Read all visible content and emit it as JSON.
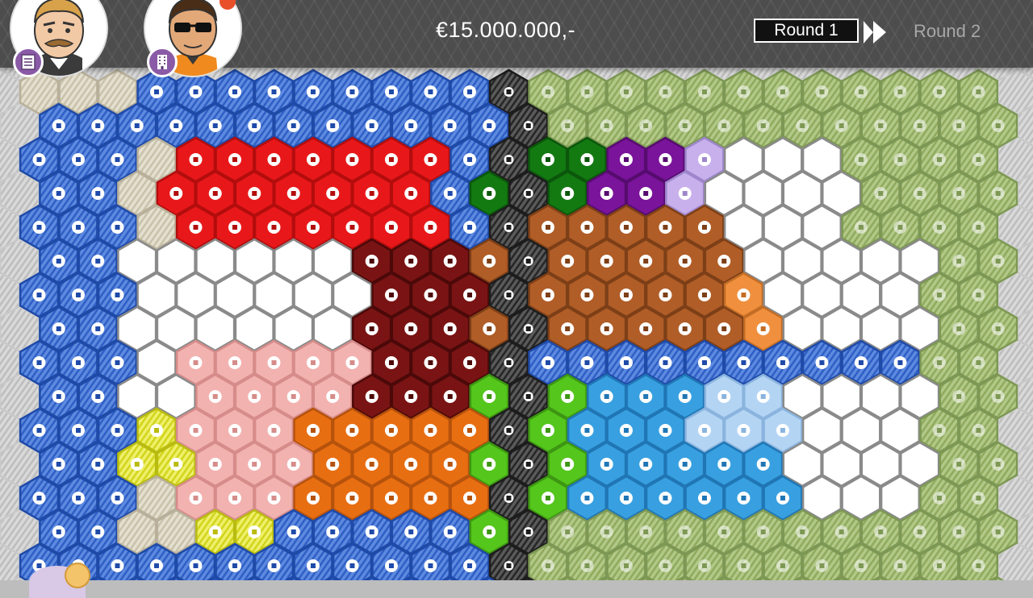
{
  "header": {
    "budget": "€15.000.000,-",
    "round_current": "Round 1",
    "round_next": "Round 2"
  },
  "players": [
    {
      "name": "player-mayor",
      "role_icon": "document-icon"
    },
    {
      "name": "player-developer",
      "role_icon": "building-icon",
      "has_notification": true
    }
  ],
  "legend_colors": {
    "water": "#2f64c9",
    "infrastructure": "#3a3a3a",
    "nature": "#9bb86a",
    "vacant": "#ffffff",
    "sand": "#d8d2bf",
    "cinema": "#e8181a",
    "dark_red": "#7a1414",
    "pink_housing": "#f2b2b0",
    "orange_shop": "#e86e12",
    "yellow": "#e3e436",
    "dark_green": "#137a12",
    "purple": "#7a149b",
    "lavender": "#c8b0ec",
    "brown_office": "#b05d27",
    "light_orange": "#f0903e",
    "lime": "#55c61c",
    "sky_blue": "#38a0e0",
    "pale_blue": "#b4d4f4"
  }
}
